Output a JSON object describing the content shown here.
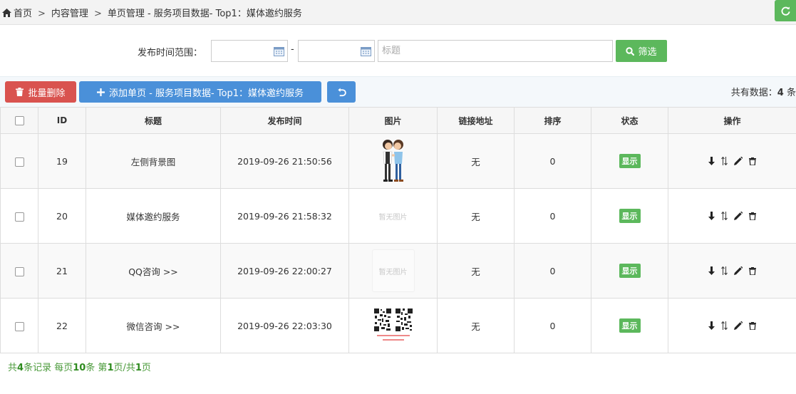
{
  "breadcrumb": {
    "home": "首页",
    "separator": ">",
    "items": [
      "内容管理",
      "单页管理 - 服务项目数据- Top1：媒体邀约服务"
    ]
  },
  "filter": {
    "label": "发布时间范围：",
    "date_from": "",
    "date_to": "",
    "dash": "-",
    "title_placeholder": "标题",
    "title_value": "",
    "submit_label": "筛选"
  },
  "toolbar": {
    "batch_delete_label": "批量删除",
    "add_label": "添加单页 - 服务项目数据- Top1：媒体邀约服务",
    "total_prefix": "共有数据：",
    "total_count": "4",
    "total_suffix": "条"
  },
  "table": {
    "headers": [
      "",
      "ID",
      "标题",
      "发布时间",
      "图片",
      "链接地址",
      "排序",
      "状态",
      "操作"
    ],
    "rows": [
      {
        "id": "19",
        "title": "左侧背景图",
        "time": "2019-09-26 21:50:56",
        "image": "couple-illustration",
        "link": "无",
        "sort": "0",
        "status": "显示"
      },
      {
        "id": "20",
        "title": "媒体邀约服务",
        "time": "2019-09-26 21:58:32",
        "image_text": "暂无图片",
        "link": "无",
        "sort": "0",
        "status": "显示"
      },
      {
        "id": "21",
        "title": "QQ咨询 >>",
        "time": "2019-09-26 22:00:27",
        "image_text": "暂无图片",
        "link": "无",
        "sort": "0",
        "status": "显示"
      },
      {
        "id": "22",
        "title": "微信咨询 >>",
        "time": "2019-09-26 22:03:30",
        "image": "qr-codes",
        "link": "无",
        "sort": "0",
        "status": "显示"
      }
    ]
  },
  "pager": {
    "p1": "共",
    "total": "4",
    "p2": "条记录 每页",
    "per_page": "10",
    "p3": "条 第",
    "page": "1",
    "p4": "页/共",
    "pages": "1",
    "p5": "页"
  },
  "colors": {
    "green": "#5cb85c",
    "red": "#d9534f",
    "blue": "#4a90d9"
  },
  "icons": [
    "home-icon",
    "refresh-icon",
    "calendar-icon",
    "search-icon",
    "trash-icon",
    "plus-icon",
    "undo-icon",
    "arrow-down-icon",
    "sort-icon",
    "edit-icon"
  ]
}
